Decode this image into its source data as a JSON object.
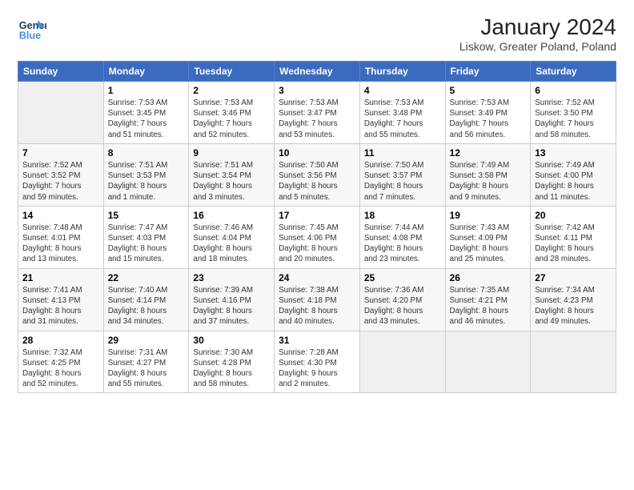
{
  "header": {
    "logo_line1": "General",
    "logo_line2": "Blue",
    "title": "January 2024",
    "subtitle": "Liskow, Greater Poland, Poland"
  },
  "days_of_week": [
    "Sunday",
    "Monday",
    "Tuesday",
    "Wednesday",
    "Thursday",
    "Friday",
    "Saturday"
  ],
  "weeks": [
    [
      {
        "day": "",
        "info": ""
      },
      {
        "day": "1",
        "info": "Sunrise: 7:53 AM\nSunset: 3:45 PM\nDaylight: 7 hours\nand 51 minutes."
      },
      {
        "day": "2",
        "info": "Sunrise: 7:53 AM\nSunset: 3:46 PM\nDaylight: 7 hours\nand 52 minutes."
      },
      {
        "day": "3",
        "info": "Sunrise: 7:53 AM\nSunset: 3:47 PM\nDaylight: 7 hours\nand 53 minutes."
      },
      {
        "day": "4",
        "info": "Sunrise: 7:53 AM\nSunset: 3:48 PM\nDaylight: 7 hours\nand 55 minutes."
      },
      {
        "day": "5",
        "info": "Sunrise: 7:53 AM\nSunset: 3:49 PM\nDaylight: 7 hours\nand 56 minutes."
      },
      {
        "day": "6",
        "info": "Sunrise: 7:52 AM\nSunset: 3:50 PM\nDaylight: 7 hours\nand 58 minutes."
      }
    ],
    [
      {
        "day": "7",
        "info": "Sunrise: 7:52 AM\nSunset: 3:52 PM\nDaylight: 7 hours\nand 59 minutes."
      },
      {
        "day": "8",
        "info": "Sunrise: 7:51 AM\nSunset: 3:53 PM\nDaylight: 8 hours\nand 1 minute."
      },
      {
        "day": "9",
        "info": "Sunrise: 7:51 AM\nSunset: 3:54 PM\nDaylight: 8 hours\nand 3 minutes."
      },
      {
        "day": "10",
        "info": "Sunrise: 7:50 AM\nSunset: 3:56 PM\nDaylight: 8 hours\nand 5 minutes."
      },
      {
        "day": "11",
        "info": "Sunrise: 7:50 AM\nSunset: 3:57 PM\nDaylight: 8 hours\nand 7 minutes."
      },
      {
        "day": "12",
        "info": "Sunrise: 7:49 AM\nSunset: 3:58 PM\nDaylight: 8 hours\nand 9 minutes."
      },
      {
        "day": "13",
        "info": "Sunrise: 7:49 AM\nSunset: 4:00 PM\nDaylight: 8 hours\nand 11 minutes."
      }
    ],
    [
      {
        "day": "14",
        "info": "Sunrise: 7:48 AM\nSunset: 4:01 PM\nDaylight: 8 hours\nand 13 minutes."
      },
      {
        "day": "15",
        "info": "Sunrise: 7:47 AM\nSunset: 4:03 PM\nDaylight: 8 hours\nand 15 minutes."
      },
      {
        "day": "16",
        "info": "Sunrise: 7:46 AM\nSunset: 4:04 PM\nDaylight: 8 hours\nand 18 minutes."
      },
      {
        "day": "17",
        "info": "Sunrise: 7:45 AM\nSunset: 4:06 PM\nDaylight: 8 hours\nand 20 minutes."
      },
      {
        "day": "18",
        "info": "Sunrise: 7:44 AM\nSunset: 4:08 PM\nDaylight: 8 hours\nand 23 minutes."
      },
      {
        "day": "19",
        "info": "Sunrise: 7:43 AM\nSunset: 4:09 PM\nDaylight: 8 hours\nand 25 minutes."
      },
      {
        "day": "20",
        "info": "Sunrise: 7:42 AM\nSunset: 4:11 PM\nDaylight: 8 hours\nand 28 minutes."
      }
    ],
    [
      {
        "day": "21",
        "info": "Sunrise: 7:41 AM\nSunset: 4:13 PM\nDaylight: 8 hours\nand 31 minutes."
      },
      {
        "day": "22",
        "info": "Sunrise: 7:40 AM\nSunset: 4:14 PM\nDaylight: 8 hours\nand 34 minutes."
      },
      {
        "day": "23",
        "info": "Sunrise: 7:39 AM\nSunset: 4:16 PM\nDaylight: 8 hours\nand 37 minutes."
      },
      {
        "day": "24",
        "info": "Sunrise: 7:38 AM\nSunset: 4:18 PM\nDaylight: 8 hours\nand 40 minutes."
      },
      {
        "day": "25",
        "info": "Sunrise: 7:36 AM\nSunset: 4:20 PM\nDaylight: 8 hours\nand 43 minutes."
      },
      {
        "day": "26",
        "info": "Sunrise: 7:35 AM\nSunset: 4:21 PM\nDaylight: 8 hours\nand 46 minutes."
      },
      {
        "day": "27",
        "info": "Sunrise: 7:34 AM\nSunset: 4:23 PM\nDaylight: 8 hours\nand 49 minutes."
      }
    ],
    [
      {
        "day": "28",
        "info": "Sunrise: 7:32 AM\nSunset: 4:25 PM\nDaylight: 8 hours\nand 52 minutes."
      },
      {
        "day": "29",
        "info": "Sunrise: 7:31 AM\nSunset: 4:27 PM\nDaylight: 8 hours\nand 55 minutes."
      },
      {
        "day": "30",
        "info": "Sunrise: 7:30 AM\nSunset: 4:28 PM\nDaylight: 8 hours\nand 58 minutes."
      },
      {
        "day": "31",
        "info": "Sunrise: 7:28 AM\nSunset: 4:30 PM\nDaylight: 9 hours\nand 2 minutes."
      },
      {
        "day": "",
        "info": ""
      },
      {
        "day": "",
        "info": ""
      },
      {
        "day": "",
        "info": ""
      }
    ]
  ]
}
